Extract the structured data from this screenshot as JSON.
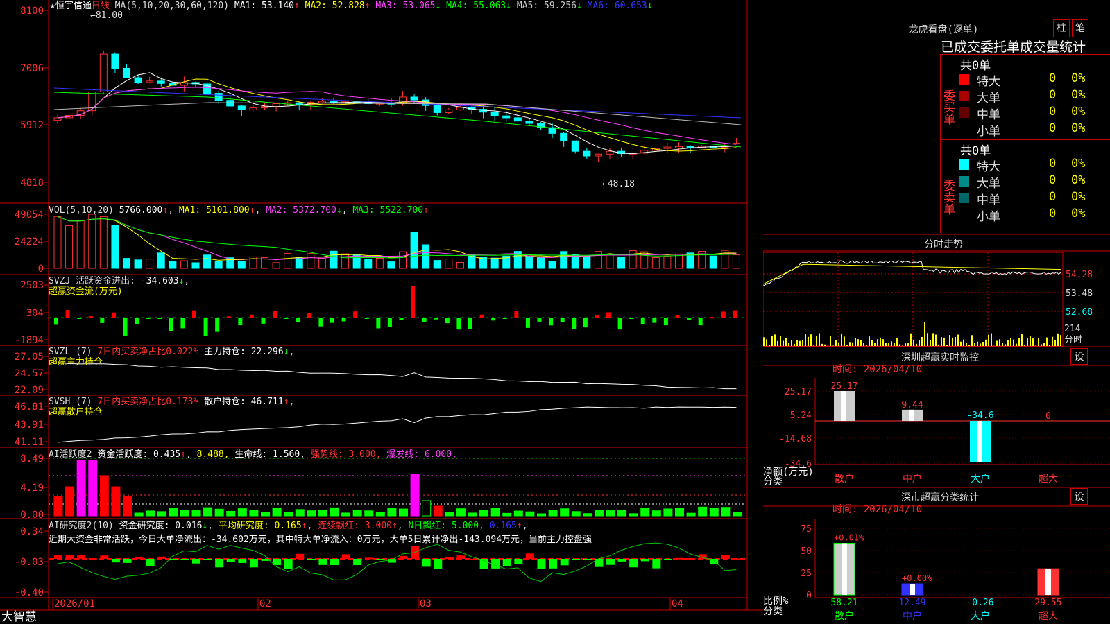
{
  "main_chart": {
    "symbol": "★恒宇信通",
    "period": "日线",
    "ma_params": "MA(5,10,20,30,60,120)",
    "ma": [
      {
        "name": "MA1:",
        "value": "53.140",
        "arrow": "↑",
        "color": "#ffffff"
      },
      {
        "name": "MA2:",
        "value": "52.828",
        "arrow": "↑",
        "color": "#ffff00"
      },
      {
        "name": "MA3:",
        "value": "53.065",
        "arrow": "↓",
        "color": "#ff44ff"
      },
      {
        "name": "MA4:",
        "value": "55.063",
        "arrow": "↓",
        "color": "#00ff00"
      },
      {
        "name": "MA5:",
        "value": "59.256",
        "arrow": "↓",
        "color": "#cccccc"
      },
      {
        "name": "MA6:",
        "value": "60.653",
        "arrow": "↓",
        "color": "#3333ff"
      }
    ],
    "yticks": [
      "8100",
      "7006",
      "5912",
      "4818"
    ],
    "high_label": "81.00",
    "low_label": "48.18"
  },
  "vol": {
    "title": "VOL(5,10,20)",
    "value": "5766.000",
    "ma1": "5101.800",
    "ma2": "5372.700",
    "ma3": "5522.700",
    "yticks": [
      "49054",
      "24224",
      "0"
    ]
  },
  "svzj": {
    "title": "SVZJ  活跃资金进出: ",
    "value": "-34.603",
    "sub": "超赢资金流(万元)",
    "yticks": [
      "2503",
      "304",
      "-1894"
    ]
  },
  "svzl": {
    "title": "SVZL (7)",
    "desc": "7日内买卖净占比0.022%",
    "k": "主力持仓: 22.296",
    "sub": "超赢主力持仓",
    "yticks": [
      "27.05",
      "24.57",
      "22.09"
    ]
  },
  "svsh": {
    "title": "SVSH (7)",
    "desc": "7日内买卖净占比0.173%",
    "k": "散户持仓: 46.711",
    "sub": "超赢散户持仓",
    "yticks": [
      "46.81",
      "43.91",
      "41.11"
    ]
  },
  "ai_active": {
    "title": "AI活跃度2",
    "a": "资金活跃度: 0.435",
    "b": "8.488,",
    "c": "生命线: 1.560,",
    "d": "强势线: 3.000,",
    "e": "爆发线: 6.000,",
    "yticks": [
      "8.49",
      "4.19",
      "0.00"
    ]
  },
  "ai_research": {
    "title": "AI研究度2(10)",
    "a": "资金研究度: 0.016",
    "b": "平均研究度: 0.165",
    "c": "连续飘红: 3.000",
    "d": "N日飘红: 5.000,",
    "e": "0.165",
    "note": "近期大资金非常活跃，今日大单净流出：-34.602万元，其中特大单净流入：0万元，大单5日累计净出-143.094万元，当前主力控盘强",
    "yticks": [
      "0.34",
      "-0.03",
      "-0.40"
    ]
  },
  "bottom": {
    "brand": "大智慧",
    "dates": [
      "2026/01",
      "02",
      "03",
      "04"
    ]
  },
  "dragon": {
    "title": "龙虎看盘(逐单)",
    "btn1": "柱",
    "btn2": "笔",
    "subtitle": "已成交委托单成交量统计",
    "buy": {
      "label": "委买单",
      "total": "共0单",
      "rows": [
        {
          "name": "特大",
          "v": "0",
          "p": "0%",
          "color": "#ff0000"
        },
        {
          "name": "大单",
          "v": "0",
          "p": "0%",
          "color": "#aa0000"
        },
        {
          "name": "中单",
          "v": "0",
          "p": "0%",
          "color": "#660000"
        },
        {
          "name": "小单",
          "v": "0",
          "p": "0%",
          "color": "#000"
        }
      ]
    },
    "sell": {
      "label": "委卖单",
      "total": "共0单",
      "rows": [
        {
          "name": "特大",
          "v": "0",
          "p": "0%",
          "color": "#00ffff"
        },
        {
          "name": "大单",
          "v": "0",
          "p": "0%",
          "color": "#008b8b"
        },
        {
          "name": "中单",
          "v": "0",
          "p": "0%",
          "color": "#006666"
        },
        {
          "name": "小单",
          "v": "0",
          "p": "0%",
          "color": "#000"
        }
      ]
    }
  },
  "intraday": {
    "title": "分时走势",
    "yticks": [
      "54.28",
      "53.48",
      "52.68"
    ],
    "vol_label": "214",
    "vol_unit": "分时"
  },
  "sz_monitor": {
    "title": "深圳超赢实时监控",
    "btn": "设",
    "time": "时间: 2026/04/10",
    "yticks": [
      "25.17",
      "5.24",
      "-14.68",
      "-34.6"
    ],
    "ylabel": "净额(万元)",
    "xlabel": "分类",
    "cats": [
      "散户",
      "中户",
      "大户",
      "超大"
    ],
    "vals": [
      "25.17",
      "9.44",
      "-34.6",
      "0"
    ]
  },
  "sz_class": {
    "title": "深市超赢分类统计",
    "btn": "设",
    "time": "时间: 2026/04/10",
    "yticks": [
      "75",
      "50",
      "25",
      "0"
    ],
    "ylabel": "比例%",
    "xlabel": "分类",
    "cats": [
      "散户",
      "中户",
      "大户",
      "超大"
    ],
    "tops": [
      "+0.01%",
      "+0.00%",
      "",
      ""
    ],
    "vals": [
      "58.21",
      "12.49",
      "-0.26",
      "29.55"
    ]
  }
}
